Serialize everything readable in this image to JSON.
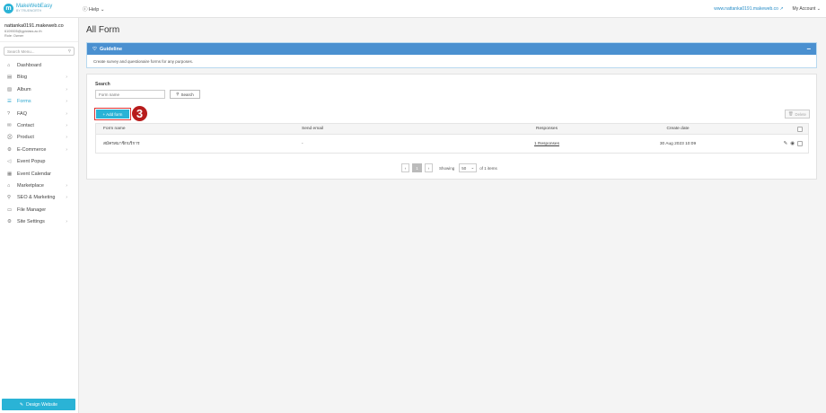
{
  "topbar": {
    "logo_name": "MakeWebEasy",
    "logo_sub": "BY TRUEWORTH",
    "help_label": "Help",
    "site_link": "www.nattanka0191.makeweb.co",
    "account_label": "My Account"
  },
  "user": {
    "name": "nattanka0191.makeweb.co",
    "email": "6109005@gpiclass.ac.th",
    "role": "Role: Owner"
  },
  "sidebar": {
    "search_placeholder": "Search Menu...",
    "items": [
      {
        "label": "Dashboard",
        "icon": "home-icon",
        "glyph": "⌂",
        "chevron": false
      },
      {
        "label": "Blog",
        "icon": "document-icon",
        "glyph": "▤",
        "chevron": true
      },
      {
        "label": "Album",
        "icon": "image-icon",
        "glyph": "▨",
        "chevron": true
      },
      {
        "label": "Forms",
        "icon": "forms-icon",
        "glyph": "☰",
        "chevron": true,
        "active": true
      },
      {
        "label": "FAQ",
        "icon": "question-icon",
        "glyph": "?",
        "chevron": true
      },
      {
        "label": "Contact",
        "icon": "envelope-icon",
        "glyph": "✉",
        "chevron": true
      },
      {
        "label": "Product",
        "icon": "cart-icon",
        "glyph": "⛒",
        "chevron": true
      },
      {
        "label": "E-Commerce",
        "icon": "gear-icon",
        "glyph": "⚙",
        "chevron": true
      },
      {
        "label": "Event Popup",
        "icon": "megaphone-icon",
        "glyph": "◁",
        "chevron": false
      },
      {
        "label": "Event Calendar",
        "icon": "calendar-icon",
        "glyph": "▦",
        "chevron": false
      },
      {
        "label": "Marketplace",
        "icon": "store-icon",
        "glyph": "⌂",
        "chevron": true
      },
      {
        "label": "SEO & Marketing",
        "icon": "search-icon",
        "glyph": "⚲",
        "chevron": true
      },
      {
        "label": "File Manager",
        "icon": "folder-icon",
        "glyph": "▭",
        "chevron": false
      },
      {
        "label": "Site Settings",
        "icon": "settings-icon",
        "glyph": "⚙",
        "chevron": true
      }
    ],
    "design_button": "Design Website"
  },
  "main": {
    "title": "All Form",
    "guideline_title": "Guideline",
    "guideline_text": "Create survey and questionaire forms for any purposes.",
    "search_label": "Search",
    "form_name_placeholder": "Form name",
    "search_button": "Search",
    "add_form_button": "+ Add form",
    "step_badge": "3",
    "delete_button": "Delete"
  },
  "table": {
    "headers": {
      "name": "Form name",
      "email": "Send email",
      "responses": "Responses",
      "date": "Create date"
    },
    "rows": [
      {
        "name": "สมัครสมาชิกบริการ",
        "email": "-",
        "responses": "1 Responses",
        "date": "30 Aug 2023 10:09"
      }
    ]
  },
  "pagination": {
    "prev": "‹",
    "current_page": "1",
    "next": "›",
    "showing_label": "Showing",
    "per_page": "50",
    "total_text": "of 1 items"
  }
}
